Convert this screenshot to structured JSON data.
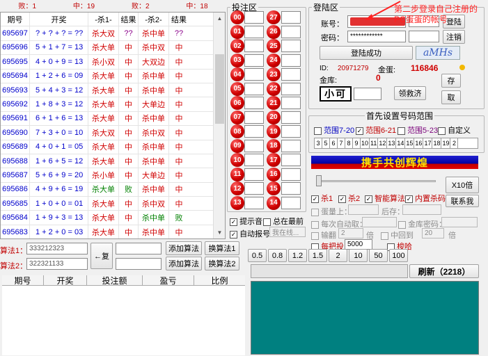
{
  "summary": {
    "lose1": "败：1",
    "mid": "中：19",
    "lose2": "败：2",
    "mid2": "中：18"
  },
  "history": {
    "headers": [
      "期号",
      "开奖",
      "-杀1-",
      "结果",
      "-杀2-",
      "结果"
    ],
    "rows": [
      {
        "period": "695697",
        "draw": "? + ? + ? = ??",
        "kill1": "杀大双",
        "k1c": "red",
        "res1": "??",
        "r1c": "purple",
        "kill2": "杀中单",
        "k2c": "red",
        "res2": "??",
        "r2c": "purple"
      },
      {
        "period": "695696",
        "draw": "5 + 1 + 7 = 13",
        "kill1": "杀大单",
        "k1c": "red",
        "res1": "中",
        "r1c": "red",
        "kill2": "杀中双",
        "k2c": "red",
        "res2": "中",
        "r2c": "red"
      },
      {
        "period": "695695",
        "draw": "4 + 0 + 9 = 13",
        "kill1": "杀小双",
        "k1c": "red",
        "res1": "中",
        "r1c": "red",
        "kill2": "大双边",
        "k2c": "red",
        "res2": "中",
        "r2c": "red"
      },
      {
        "period": "695694",
        "draw": "1 + 2 + 6 = 09",
        "kill1": "杀大单",
        "k1c": "red",
        "res1": "中",
        "r1c": "red",
        "kill2": "杀中单",
        "k2c": "red",
        "res2": "中",
        "r2c": "red"
      },
      {
        "period": "695693",
        "draw": "5 + 4 + 3 = 12",
        "kill1": "杀大单",
        "k1c": "red",
        "res1": "中",
        "r1c": "red",
        "kill2": "杀中单",
        "k2c": "red",
        "res2": "中",
        "r2c": "red"
      },
      {
        "period": "695692",
        "draw": "1 + 8 + 3 = 12",
        "kill1": "杀大单",
        "k1c": "red",
        "res1": "中",
        "r1c": "red",
        "kill2": "大单边",
        "k2c": "red",
        "res2": "中",
        "r2c": "red"
      },
      {
        "period": "695691",
        "draw": "6 + 1 + 6 = 13",
        "kill1": "杀大单",
        "k1c": "red",
        "res1": "中",
        "r1c": "red",
        "kill2": "杀中单",
        "k2c": "red",
        "res2": "中",
        "r2c": "red"
      },
      {
        "period": "695690",
        "draw": "7 + 3 + 0 = 10",
        "kill1": "杀大双",
        "k1c": "red",
        "res1": "中",
        "r1c": "red",
        "kill2": "杀中双",
        "k2c": "red",
        "res2": "中",
        "r2c": "red"
      },
      {
        "period": "695689",
        "draw": "4 + 0 + 1 = 05",
        "kill1": "杀大单",
        "k1c": "red",
        "res1": "中",
        "r1c": "red",
        "kill2": "杀中单",
        "k2c": "red",
        "res2": "中",
        "r2c": "red"
      },
      {
        "period": "695688",
        "draw": "1 + 6 + 5 = 12",
        "kill1": "杀大单",
        "k1c": "red",
        "res1": "中",
        "r1c": "red",
        "kill2": "杀中单",
        "k2c": "red",
        "res2": "中",
        "r2c": "red"
      },
      {
        "period": "695687",
        "draw": "5 + 6 + 9 = 20",
        "kill1": "杀小单",
        "k1c": "red",
        "res1": "中",
        "r1c": "red",
        "kill2": "大单边",
        "k2c": "red",
        "res2": "中",
        "r2c": "red"
      },
      {
        "period": "695686",
        "draw": "4 + 9 + 6 = 19",
        "kill1": "杀大单",
        "k1c": "green",
        "res1": "败",
        "r1c": "green",
        "kill2": "杀中单",
        "k2c": "red",
        "res2": "中",
        "r2c": "red"
      },
      {
        "period": "695685",
        "draw": "1 + 0 + 0 = 01",
        "kill1": "杀大单",
        "k1c": "red",
        "res1": "中",
        "r1c": "red",
        "kill2": "杀中双",
        "k2c": "red",
        "res2": "中",
        "r2c": "red"
      },
      {
        "period": "695684",
        "draw": "1 + 9 + 3 = 13",
        "kill1": "杀大单",
        "k1c": "red",
        "res1": "中",
        "r1c": "red",
        "kill2": "杀中单",
        "k2c": "green",
        "res2": "败",
        "r2c": "green"
      },
      {
        "period": "695683",
        "draw": "1 + 2 + 0 = 03",
        "kill1": "杀大单",
        "k1c": "red",
        "res1": "中",
        "r1c": "red",
        "kill2": "杀中单",
        "k2c": "red",
        "res2": "中",
        "r2c": "red"
      }
    ]
  },
  "algo": {
    "label1": "算法1：",
    "value1": "333212323",
    "label2": "算法2：",
    "value2": "322321133",
    "copy_label": "←复",
    "add_label": "添加算法",
    "swap1_label": "换算法1",
    "swap2_label": "换算法2"
  },
  "bet_table": {
    "headers": [
      "期号",
      "开奖",
      "投注额",
      "盈亏",
      "比例"
    ]
  },
  "bet_area": {
    "legend": "投注区",
    "balls_left": [
      "00",
      "01",
      "02",
      "03",
      "04",
      "05",
      "06",
      "07",
      "08",
      "09",
      "10",
      "11",
      "12",
      "13"
    ],
    "balls_right": [
      "27",
      "26",
      "25",
      "24",
      "23",
      "22",
      "21",
      "20",
      "19",
      "18",
      "17",
      "16",
      "15",
      "14"
    ],
    "hint_sound": "提示音",
    "always_top": "总在最前",
    "auto_report": "自动报号",
    "report_select": "我在线..."
  },
  "login": {
    "legend": "登陆区",
    "account_label": "账号：",
    "password_label": "密码：",
    "password_value": "************",
    "login_btn": "登陆",
    "logout_btn": "注销",
    "success_btn": "登陆成功",
    "captcha_text": "aMHs",
    "id_label": "ID:",
    "id_value": "20971279",
    "egg_label": "金蛋:",
    "egg_value": "116846",
    "bank_label": "金库:",
    "bank_value": "0",
    "save_btn": "存",
    "withdraw_btn": "取",
    "code_text": "小可",
    "claim_btn": "领救济",
    "annotation": "第二步登录自己注册的PC蛋蛋的帐号"
  },
  "range": {
    "legend": "首先设置号码范围",
    "opt1": "范围7-20",
    "opt2": "范围6-21",
    "opt3": "范围5-23",
    "opt4": "自定义",
    "numbers": [
      "3",
      "5",
      "6",
      "7",
      "8",
      "9",
      "10",
      "11",
      "12",
      "13",
      "14",
      "15",
      "16",
      "17",
      "18",
      "19",
      "2"
    ]
  },
  "banner": "携手共创辉煌",
  "strategy": {
    "x10": "X10倍",
    "contact": "联系我",
    "kill1": "杀1",
    "kill2": "杀2",
    "smart": "智能算法",
    "builtin": "内置杀码",
    "egg_above": "蛋量上：",
    "next_save": "后存：",
    "auto_take": "每次自动取：",
    "bank_pwd": "金库密码：",
    "lose_label": "输翻",
    "lose_value": "2",
    "lose_unit": "倍",
    "mid_back": "中回到",
    "mid_value": "20",
    "mid_unit": "倍",
    "each_bet": "每把投",
    "each_value": "5000",
    "hedge": "梭哈"
  },
  "multipliers": [
    "0.5",
    "0.8",
    "1.2",
    "1.5",
    "2",
    "10",
    "50",
    "100"
  ],
  "refresh": "刷新（2218）"
}
